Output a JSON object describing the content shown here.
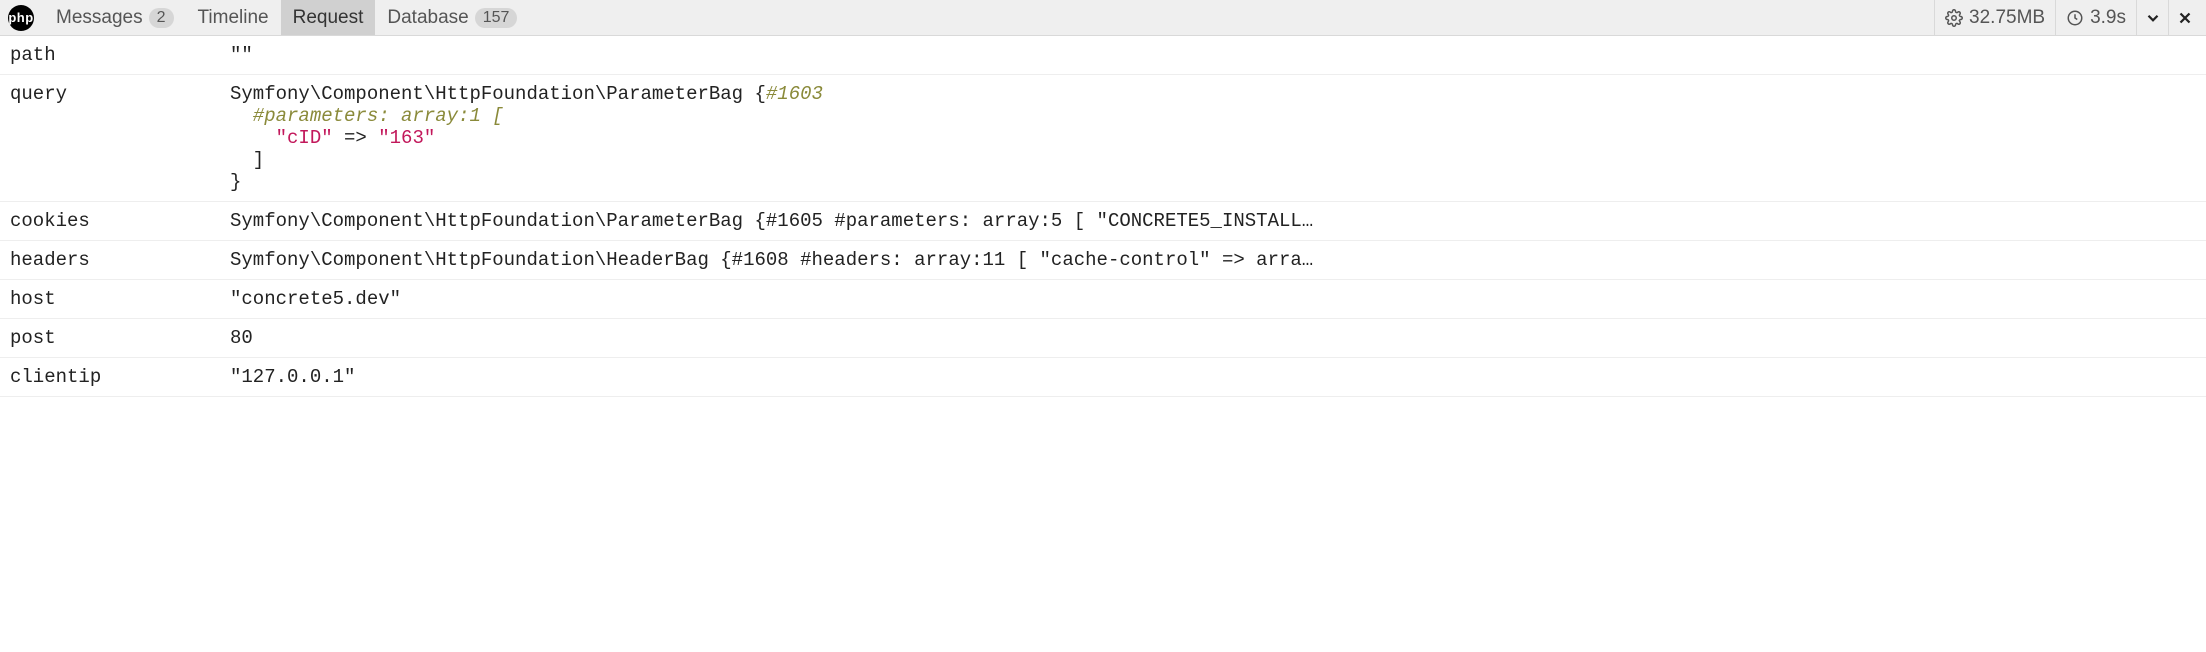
{
  "toolbar": {
    "logo_text": "php",
    "tabs": [
      {
        "label": "Messages",
        "badge": "2",
        "active": false
      },
      {
        "label": "Timeline",
        "badge": null,
        "active": false
      },
      {
        "label": "Request",
        "badge": null,
        "active": true
      },
      {
        "label": "Database",
        "badge": "157",
        "active": false
      }
    ],
    "memory": "32.75MB",
    "time": "3.9s"
  },
  "rows": {
    "path": {
      "key": "path",
      "plain": "\"\""
    },
    "query": {
      "key": "query",
      "class_path": "Symfony\\Component\\HttpFoundation\\ParameterBag",
      "open_brace": " {",
      "object_id_token": "#1603",
      "line_params_comment": "  #parameters: array:1 [",
      "param_key": "\"cID\"",
      "param_arrow": " => ",
      "param_val": "\"163\"",
      "line_close_bracket": "  ]",
      "line_close_brace": "}"
    },
    "cookies": {
      "key": "cookies",
      "plain": "Symfony\\Component\\HttpFoundation\\ParameterBag {#1605 #parameters: array:5 [ \"CONCRETE5_INSTALL…"
    },
    "headers": {
      "key": "headers",
      "plain": "Symfony\\Component\\HttpFoundation\\HeaderBag {#1608 #headers: array:11 [ \"cache-control\" => arra…"
    },
    "host": {
      "key": "host",
      "plain": "\"concrete5.dev\""
    },
    "post": {
      "key": "post",
      "plain": "80"
    },
    "clientip": {
      "key": "clientip",
      "plain": "\"127.0.0.1\""
    }
  }
}
